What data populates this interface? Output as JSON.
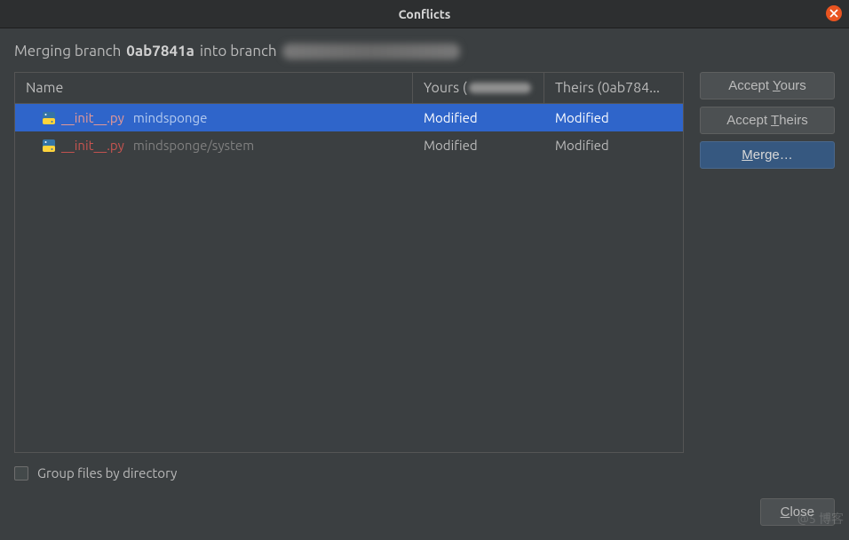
{
  "window": {
    "title": "Conflicts"
  },
  "message": {
    "prefix": "Merging branch",
    "source_branch": "0ab7841a",
    "middle": "into branch"
  },
  "table": {
    "headers": {
      "name": "Name",
      "yours": "Yours (",
      "theirs": "Theirs (0ab784..."
    },
    "rows": [
      {
        "filename": "__init__.py",
        "filepath": "mindsponge",
        "yours": "Modified",
        "theirs": "Modified",
        "selected": true
      },
      {
        "filename": "__init__.py",
        "filepath": "mindsponge/system",
        "yours": "Modified",
        "theirs": "Modified",
        "selected": false
      }
    ]
  },
  "buttons": {
    "accept_yours_pre": "Accept ",
    "accept_yours_u": "Y",
    "accept_yours_post": "ours",
    "accept_theirs_pre": "Accept ",
    "accept_theirs_u": "T",
    "accept_theirs_post": "heirs",
    "merge_u": "M",
    "merge_post": "erge…",
    "close_u": "C",
    "close_post": "lose"
  },
  "checkbox": {
    "label": "Group files by directory"
  },
  "watermark": "@5  博客"
}
